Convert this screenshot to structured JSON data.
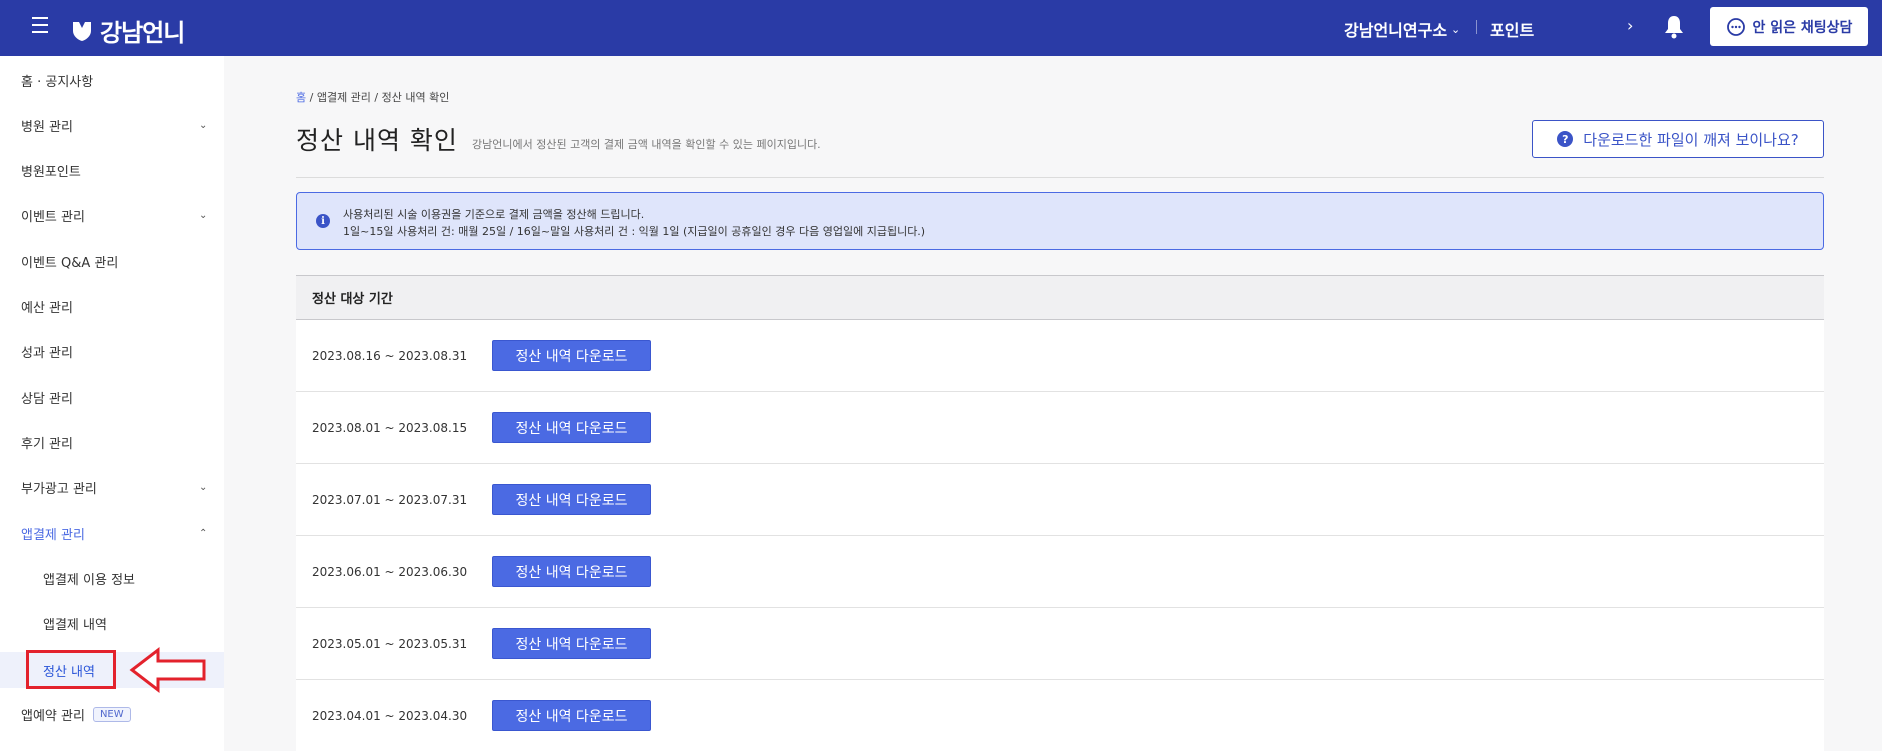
{
  "header": {
    "logo_text": "강남언니",
    "hospital_name": "강남언니연구소",
    "points_label": "포인트",
    "chat_button_label": "안 읽은 채팅상담"
  },
  "sidebar": {
    "items": [
      {
        "label": "홈 · 공지사항"
      },
      {
        "label": "병원 관리"
      },
      {
        "label": "병원포인트"
      },
      {
        "label": "이벤트 관리"
      },
      {
        "label": "이벤트 Q&A 관리"
      },
      {
        "label": "예산 관리"
      },
      {
        "label": "성과 관리"
      },
      {
        "label": "상담 관리"
      },
      {
        "label": "후기 관리"
      },
      {
        "label": "부가광고 관리"
      },
      {
        "label": "앱결제 관리"
      },
      {
        "label": "앱결제 이용 정보"
      },
      {
        "label": "앱결제 내역"
      },
      {
        "label": "정산 내역"
      },
      {
        "label": "앱예약 관리",
        "badge": "NEW"
      }
    ]
  },
  "breadcrumb": {
    "home": "홈",
    "rest": " / 앱결제 관리 / 정산 내역 확인"
  },
  "page": {
    "title": "정산 내역 확인",
    "description": "강남언니에서 정산된 고객의 결제 금액 내역을 확인할 수 있는 페이지입니다.",
    "help_button_label": "다운로드한 파일이 깨져 보이나요?"
  },
  "info": {
    "line1": "사용처리된 시술 이용권을 기준으로 결제 금액을 정산해 드립니다.",
    "line2": "1일~15일 사용처리 건: 매월 25일 / 16일~말일 사용처리 건 : 익월 1일 (지급일이 공휴일인 경우 다음 영업일에 지급됩니다.)"
  },
  "table": {
    "header": "정산 대상 기간",
    "download_label": "정산 내역 다운로드",
    "rows": [
      {
        "period": "2023.08.16 ~ 2023.08.31"
      },
      {
        "period": "2023.08.01 ~ 2023.08.15"
      },
      {
        "period": "2023.07.01 ~ 2023.07.31"
      },
      {
        "period": "2023.06.01 ~ 2023.06.30"
      },
      {
        "period": "2023.05.01 ~ 2023.05.31"
      },
      {
        "period": "2023.04.01 ~ 2023.04.30"
      }
    ]
  },
  "colors": {
    "header_bg": "#2a3ba6",
    "accent": "#4b6ae3",
    "annotation_red": "#e3222c"
  }
}
